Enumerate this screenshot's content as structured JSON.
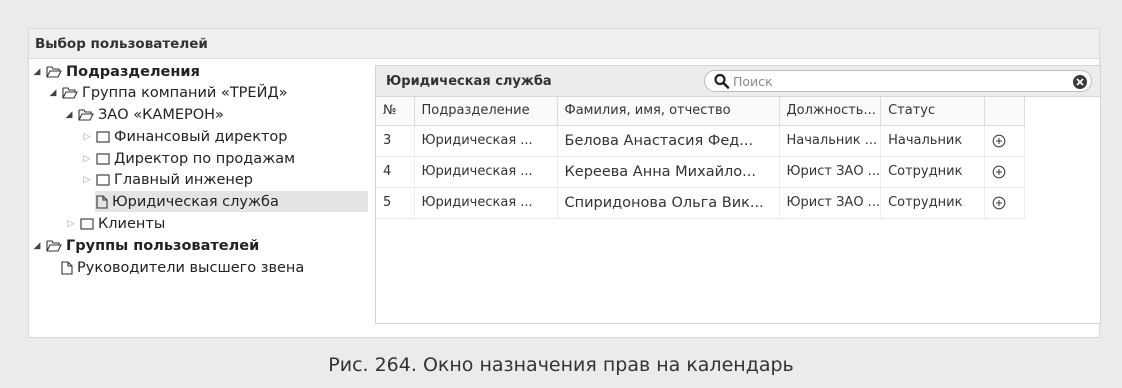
{
  "window": {
    "title": "Выбор пользователей"
  },
  "tree": {
    "nodes": [
      {
        "label": "Подразделения"
      },
      {
        "label": "Группа компаний «ТРЕЙД»"
      },
      {
        "label": "ЗАО «КАМЕРОН»"
      },
      {
        "label": "Финансовый директор"
      },
      {
        "label": "Директор по продажам"
      },
      {
        "label": "Главный инженер"
      },
      {
        "label": "Юридическая служба"
      },
      {
        "label": "Клиенты"
      },
      {
        "label": "Группы пользователей"
      },
      {
        "label": "Руководители высшего звена"
      }
    ]
  },
  "panel": {
    "title": "Юридическая служба",
    "search_placeholder": "Поиск",
    "columns": [
      "№",
      "Подразделение",
      "Фамилия, имя, отчество",
      "Должность...",
      "Статус",
      ""
    ],
    "rows": [
      {
        "num": "3",
        "dept": "Юридическая ...",
        "name": "Белова Анастасия Фед...",
        "position": "Начальник ...",
        "status": "Начальник"
      },
      {
        "num": "4",
        "dept": "Юридическая ...",
        "name": "Кереева Анна Михайло...",
        "position": "Юрист ЗАО ...",
        "status": "Сотрудник"
      },
      {
        "num": "5",
        "dept": "Юридическая ...",
        "name": "Спиридонова Ольга Вик...",
        "position": "Юрист ЗАО ...",
        "status": "Сотрудник"
      }
    ]
  },
  "caption": "Рис. 264. Окно назначения прав на календарь",
  "icons": {
    "expanded": "triangle-down-icon",
    "collapsed": "triangle-right-icon",
    "folder_open": "folder-open-icon",
    "folder_closed": "folder-closed-icon",
    "document": "document-icon",
    "search": "search-icon",
    "clear": "clear-search-icon",
    "add": "add-circle-icon"
  },
  "colors": {
    "background": "#ebebeb",
    "header": "#f0f0f0",
    "selected_row": "#e4e4e4",
    "toolbar": "#ececec"
  }
}
